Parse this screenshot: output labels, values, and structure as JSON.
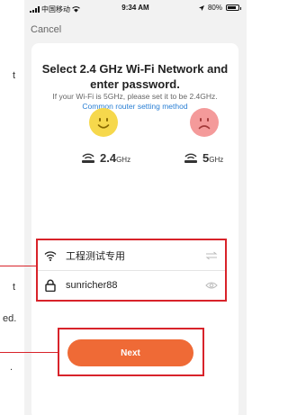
{
  "status_bar": {
    "carrier": "中国移动",
    "time": "9:34 AM",
    "battery": "80%",
    "battery_level": 0.8
  },
  "header": {
    "cancel_label": "Cancel"
  },
  "main": {
    "title": "Select 2.4 GHz Wi-Fi Network and enter password.",
    "hint": "If your Wi-Fi is 5GHz, please set it to be 2.4GHz.",
    "hint_link": "Common router setting method",
    "band_24": {
      "value": "2.4",
      "unit": "GHz"
    },
    "band_5": {
      "value": "5",
      "unit": "GHz"
    },
    "ssid": "工程测试专用",
    "password": "sunricher88",
    "next_label": "Next"
  },
  "side_fragments": [
    "t",
    "t",
    "ed.",
    "."
  ],
  "colors": {
    "accent": "#ef6a36",
    "highlight_box": "#d8232a",
    "happy_face": "#f6d84c",
    "sad_face": "#f49a9a",
    "link": "#2a7fd4"
  }
}
